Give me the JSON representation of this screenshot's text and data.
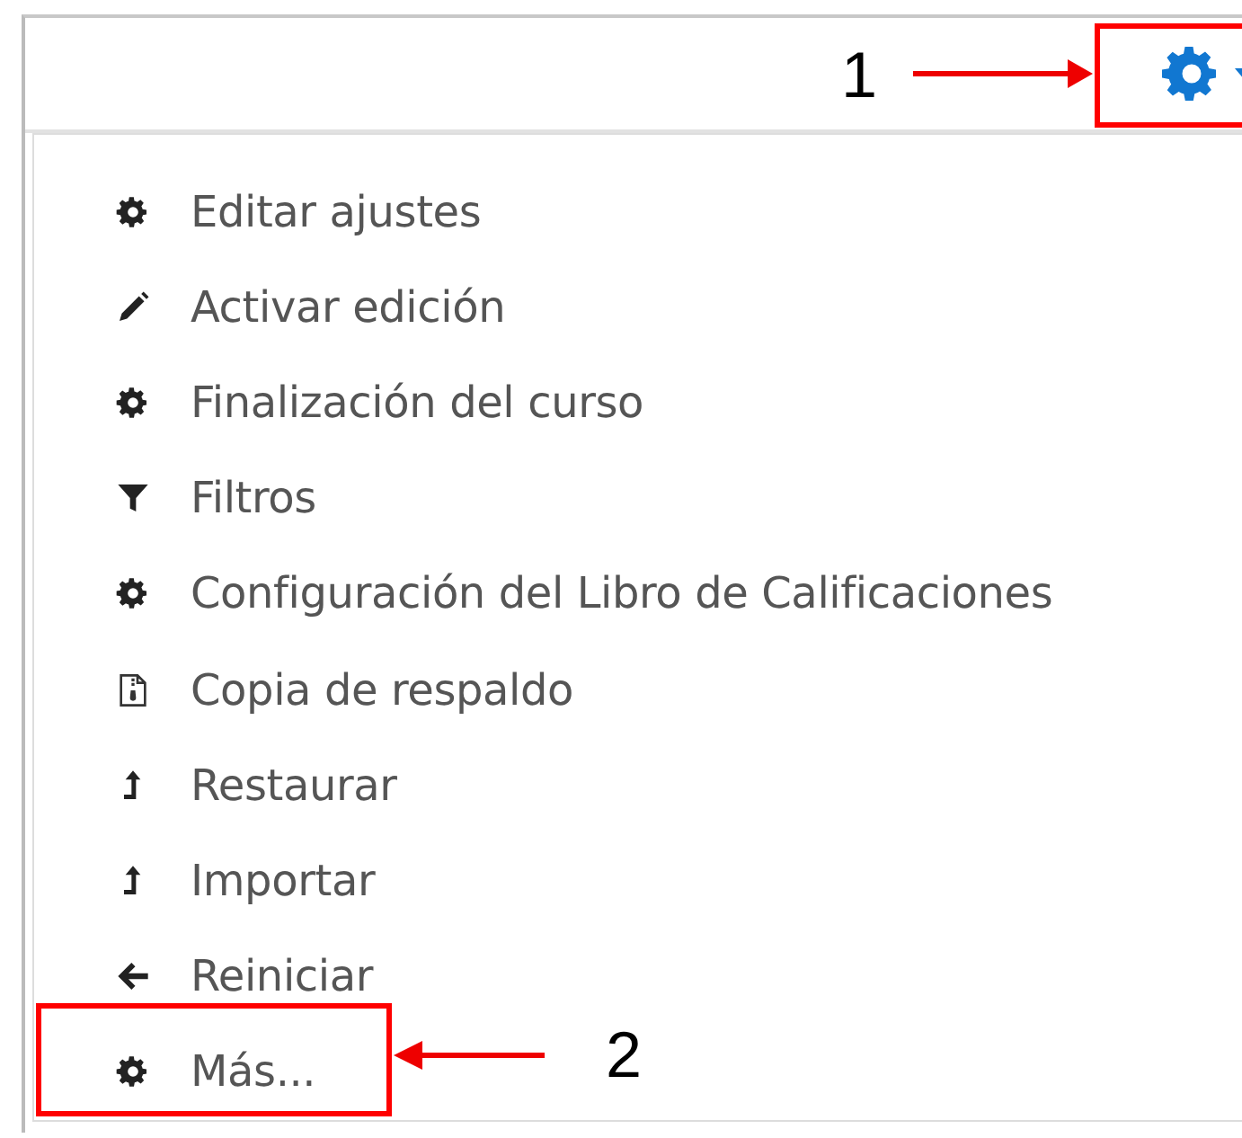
{
  "menu": {
    "items": [
      {
        "kind": "gear",
        "label": "Editar ajustes"
      },
      {
        "kind": "pencil",
        "label": "Activar edición"
      },
      {
        "kind": "gear",
        "label": "Finalización del curso"
      },
      {
        "kind": "filter",
        "label": "Filtros"
      },
      {
        "kind": "gear",
        "label": "Configuración del Libro de Calificaciones"
      },
      {
        "kind": "file",
        "label": "Copia de respaldo"
      },
      {
        "kind": "upload",
        "label": "Restaurar"
      },
      {
        "kind": "upload",
        "label": "Importar"
      },
      {
        "kind": "back",
        "label": "Reiniciar"
      },
      {
        "kind": "gear",
        "label": "Más..."
      }
    ]
  },
  "callouts": [
    {
      "label": "1"
    },
    {
      "label": "2"
    }
  ]
}
